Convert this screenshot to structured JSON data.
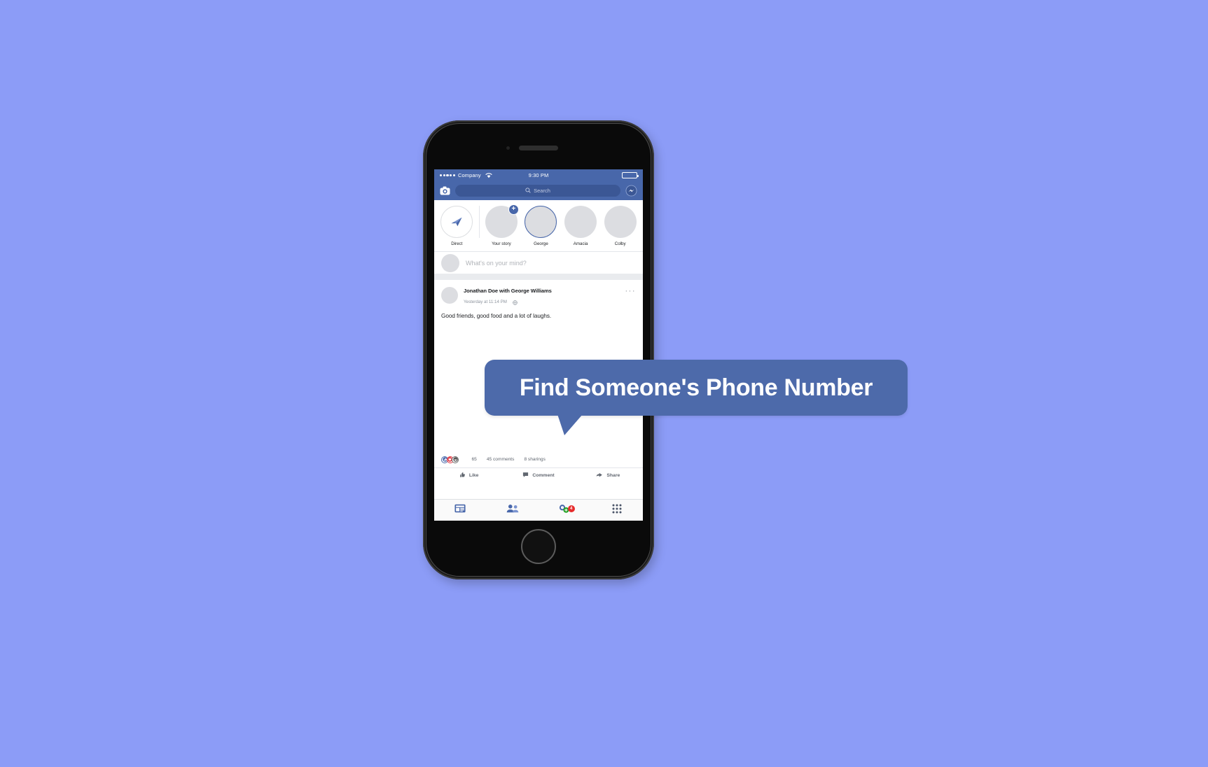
{
  "background_color": "#8c9cf7",
  "brand_color": "#4867aa",
  "callout": {
    "text": "Find Someone's Phone Number",
    "bg_color": "#4d6aaa",
    "text_color": "#ffffff"
  },
  "phone": {
    "status_bar": {
      "carrier": "Company",
      "signal_dots": 5,
      "wifi_icon": "wifi-icon",
      "time": "9:30 PM",
      "battery_icon": "battery-icon",
      "battery_level": "100"
    },
    "app_bar": {
      "camera_icon": "camera-icon",
      "search_placeholder": "Search",
      "search_icon": "search-icon",
      "messenger_icon": "messenger-icon"
    },
    "stories": [
      {
        "label": "Direct",
        "type": "direct",
        "icon": "paper-plane-icon"
      },
      {
        "label": "Your story",
        "type": "add",
        "badge": "+"
      },
      {
        "label": "George",
        "type": "active"
      },
      {
        "label": "Amacia",
        "type": "normal"
      },
      {
        "label": "Colby",
        "type": "normal"
      }
    ],
    "composer": {
      "placeholder": "What's on your mind?",
      "avatar": "user-avatar"
    },
    "post": {
      "author": "Jonathan Doe with George Williams",
      "timestamp": "Yesterday at 11:14 PM",
      "privacy_icon": "globe-icon",
      "menu_icon": "more-options-icon",
      "body": "Good friends, good food and a lot of laughs.",
      "reactions": {
        "icons": [
          "like-reaction",
          "love-reaction",
          "haha-reaction"
        ],
        "count": "65",
        "comments": "45 comments",
        "shares": "8 sharings"
      },
      "actions": [
        {
          "label": "Like",
          "icon": "thumbs-up-icon"
        },
        {
          "label": "Comment",
          "icon": "comment-icon"
        },
        {
          "label": "Share",
          "icon": "share-icon"
        }
      ]
    },
    "tab_bar": [
      {
        "name": "news-feed",
        "icon": "news-feed-icon",
        "badge": ""
      },
      {
        "name": "friends",
        "icon": "friends-icon",
        "badge": ""
      },
      {
        "name": "notifications",
        "icon": "notifications-icon",
        "badge": "4"
      },
      {
        "name": "menu",
        "icon": "grid-menu-icon",
        "badge": ""
      }
    ]
  }
}
